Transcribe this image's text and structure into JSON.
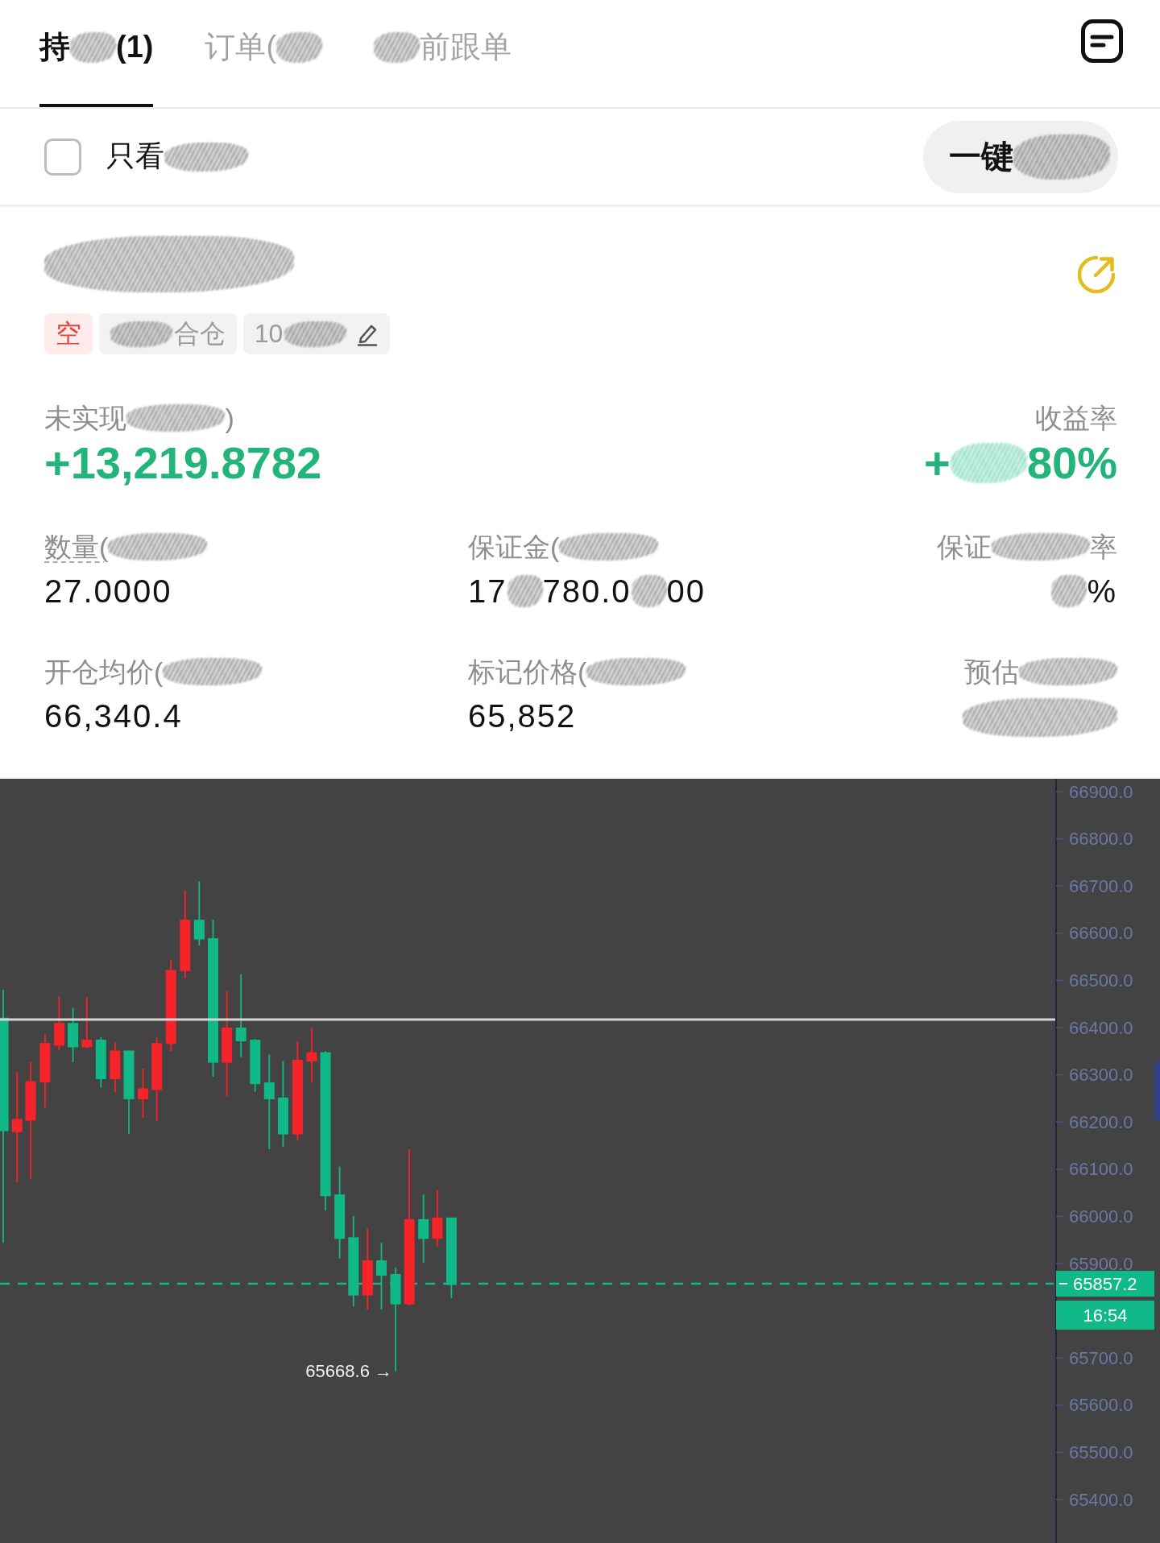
{
  "tabs": [
    {
      "segments": [
        {
          "kind": "text",
          "text": "持"
        },
        {
          "kind": "smudge"
        },
        {
          "kind": "text",
          "text": "(1)"
        }
      ],
      "selected": true
    },
    {
      "segments": [
        {
          "kind": "text",
          "text": "订单("
        },
        {
          "kind": "smudge"
        }
      ],
      "selected": false
    },
    {
      "segments": [
        {
          "kind": "smudge"
        },
        {
          "kind": "text",
          "text": "前跟单"
        }
      ],
      "selected": false
    }
  ],
  "toolbar": {
    "filter": {
      "checked": false,
      "label": [
        {
          "kind": "text",
          "text": "只看"
        },
        {
          "kind": "smudge"
        }
      ]
    },
    "action_button": [
      {
        "kind": "text",
        "text": "一键"
      },
      {
        "kind": "smudge"
      }
    ]
  },
  "position": {
    "symbol": [
      {
        "kind": "smudge"
      }
    ],
    "tags": [
      {
        "kind": "side",
        "segments": [
          {
            "kind": "text",
            "text": "空"
          }
        ]
      },
      {
        "kind": "margin_mode",
        "segments": [
          {
            "kind": "smudge"
          },
          {
            "kind": "text",
            "text": "合仓"
          }
        ]
      },
      {
        "kind": "leverage",
        "segments": [
          {
            "kind": "text",
            "text": "10"
          },
          {
            "kind": "smudge"
          }
        ]
      }
    ],
    "pnl": {
      "label": [
        {
          "kind": "text",
          "text": "未实现"
        },
        {
          "kind": "smudge"
        },
        {
          "kind": "text",
          "text": ")"
        }
      ],
      "value": "+13,219.8782"
    },
    "roe": {
      "label": [
        {
          "kind": "text",
          "text": "收益率"
        }
      ],
      "value": [
        {
          "kind": "text",
          "text": "+"
        },
        {
          "kind": "smudge"
        },
        {
          "kind": "text",
          "text": "80%"
        }
      ]
    },
    "stats": [
      {
        "has_hint": true,
        "label": [
          {
            "kind": "text",
            "text": "数量("
          },
          {
            "kind": "smudge"
          }
        ],
        "value": [
          {
            "kind": "text",
            "text": "27.0000"
          }
        ]
      },
      {
        "has_hint": false,
        "label": [
          {
            "kind": "text",
            "text": "保证金("
          },
          {
            "kind": "smudge"
          }
        ],
        "value": [
          {
            "kind": "text",
            "text": "17"
          },
          {
            "kind": "smudge"
          },
          {
            "kind": "text",
            "text": "780.0"
          },
          {
            "kind": "smudge"
          },
          {
            "kind": "text",
            "text": "00"
          }
        ]
      },
      {
        "has_hint": false,
        "label": [
          {
            "kind": "text",
            "text": "保证"
          },
          {
            "kind": "smudge"
          },
          {
            "kind": "text",
            "text": "率"
          }
        ],
        "value": [
          {
            "kind": "smudge"
          },
          {
            "kind": "text",
            "text": "%"
          }
        ]
      },
      {
        "has_hint": false,
        "label": [
          {
            "kind": "text",
            "text": "开仓均价("
          },
          {
            "kind": "smudge"
          }
        ],
        "value": [
          {
            "kind": "text",
            "text": "66,340.4"
          }
        ]
      },
      {
        "has_hint": false,
        "label": [
          {
            "kind": "text",
            "text": "标记价格("
          },
          {
            "kind": "smudge"
          }
        ],
        "value": [
          {
            "kind": "text",
            "text": "65,852"
          }
        ]
      },
      {
        "has_hint": false,
        "label": [
          {
            "kind": "text",
            "text": "预估"
          },
          {
            "kind": "smudge"
          }
        ],
        "value": [
          {
            "kind": "smudge"
          }
        ]
      }
    ]
  },
  "chart": {
    "axis_labels_upper": [
      "66900.0",
      "66800.0",
      "66700.0",
      "66600.0",
      "66500.0",
      "66400.0",
      "66300.0",
      "66200.0",
      "66100.0",
      "66000.0",
      "65900.0"
    ],
    "axis_labels_lower": [
      "65700.0",
      "65600.0",
      "65500.0",
      "65400.0"
    ],
    "last_price": "65857.2",
    "countdown": "16:54",
    "low_label": "65668.6 →"
  }
}
